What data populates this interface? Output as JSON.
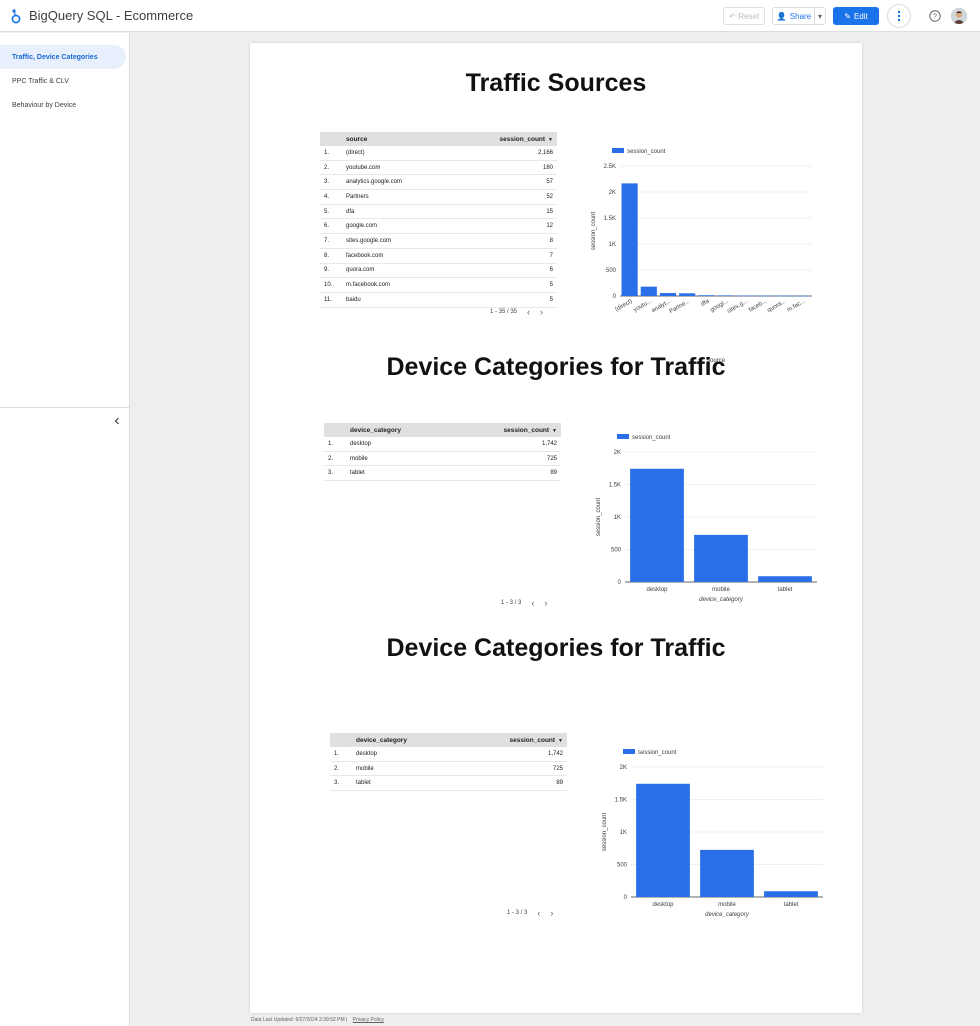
{
  "app": {
    "title": "BigQuery SQL - Ecommerce",
    "reset_label": "Reset",
    "share_label": "Share",
    "edit_label": "Edit"
  },
  "sidebar": {
    "items": [
      {
        "label": "Traffic, Device Categories"
      },
      {
        "label": "PPC Traffic & CLV"
      },
      {
        "label": "Behaviour by Device"
      }
    ]
  },
  "sections": [
    {
      "title": "Traffic Sources",
      "table": {
        "headers": [
          "source",
          "session_count"
        ],
        "rows": [
          [
            "1.",
            "(direct)",
            "2,166"
          ],
          [
            "2.",
            "youtube.com",
            "180"
          ],
          [
            "3.",
            "analytics.google.com",
            "57"
          ],
          [
            "4.",
            "Partners",
            "52"
          ],
          [
            "5.",
            "dfa",
            "15"
          ],
          [
            "6.",
            "google.com",
            "12"
          ],
          [
            "7.",
            "sites.google.com",
            "8"
          ],
          [
            "8.",
            "facebook.com",
            "7"
          ],
          [
            "9.",
            "quora.com",
            "6"
          ],
          [
            "10.",
            "m.facebook.com",
            "5"
          ],
          [
            "11.",
            "baidu",
            "5"
          ]
        ],
        "pager": "1 - 35 / 35"
      }
    },
    {
      "title": "Device Categories for Traffic",
      "table": {
        "headers": [
          "device_category",
          "session_count"
        ],
        "rows": [
          [
            "1.",
            "desktop",
            "1,742"
          ],
          [
            "2.",
            "mobile",
            "725"
          ],
          [
            "3.",
            "tablet",
            "89"
          ]
        ],
        "pager": "1 - 3 / 3"
      }
    },
    {
      "title": "Device Categories for Traffic",
      "table": {
        "headers": [
          "device_category",
          "session_count"
        ],
        "rows": [
          [
            "1.",
            "desktop",
            "1,742"
          ],
          [
            "2.",
            "mobile",
            "725"
          ],
          [
            "3.",
            "tablet",
            "89"
          ]
        ],
        "pager": "1 - 3 / 3"
      }
    }
  ],
  "chart_data": [
    {
      "type": "bar",
      "categories": [
        "(direct)",
        "youtu...",
        "analyt...",
        "Partne...",
        "dfa",
        "googl...",
        "sites.g...",
        "faceb...",
        "quora...",
        "m.fac..."
      ],
      "series": [
        {
          "name": "session_count",
          "values": [
            2166,
            180,
            57,
            52,
            15,
            12,
            8,
            7,
            6,
            5
          ]
        }
      ],
      "xlabel": "source",
      "ylabel": "session_count",
      "ylim": [
        0,
        2500
      ],
      "yticks": [
        0,
        500,
        1000,
        1500,
        2000,
        2500
      ],
      "ytick_labels": [
        "0",
        "500",
        "1K",
        "1.5K",
        "2K",
        "2.5K"
      ],
      "grid": true,
      "legend": "top-left",
      "color": "#2a6fe8"
    },
    {
      "type": "bar",
      "categories": [
        "desktop",
        "mobile",
        "tablet"
      ],
      "series": [
        {
          "name": "session_count",
          "values": [
            1742,
            725,
            89
          ]
        }
      ],
      "xlabel": "device_category",
      "ylabel": "session_count",
      "ylim": [
        0,
        2000
      ],
      "yticks": [
        0,
        500,
        1000,
        1500,
        2000
      ],
      "ytick_labels": [
        "0",
        "500",
        "1K",
        "1.5K",
        "2K"
      ],
      "grid": true,
      "legend": "top-left",
      "color": "#2a6fe8"
    },
    {
      "type": "bar",
      "categories": [
        "desktop",
        "mobile",
        "tablet"
      ],
      "series": [
        {
          "name": "session_count",
          "values": [
            1742,
            725,
            89
          ]
        }
      ],
      "xlabel": "device_category",
      "ylabel": "session_count",
      "ylim": [
        0,
        2000
      ],
      "yticks": [
        0,
        500,
        1000,
        1500,
        2000
      ],
      "ytick_labels": [
        "0",
        "500",
        "1K",
        "1.5K",
        "2K"
      ],
      "grid": true,
      "legend": "top-left",
      "color": "#2a6fe8"
    }
  ],
  "footer": {
    "last_updated": "Data Last Updated: 6/27/2024 2:39:52 PM",
    "privacy": "Privacy Policy"
  }
}
